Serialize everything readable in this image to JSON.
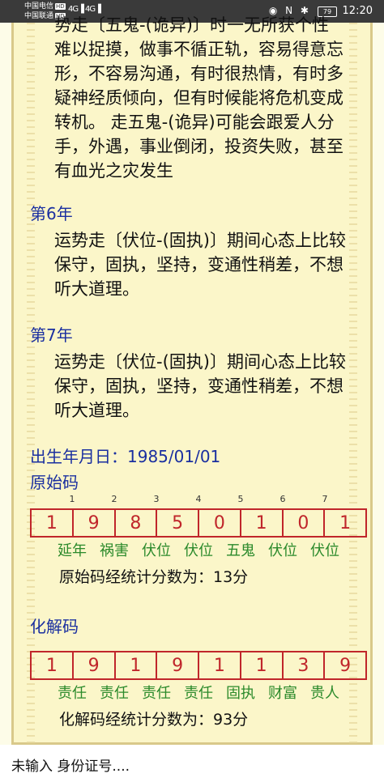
{
  "status_bar": {
    "carrier1": "中国电信",
    "carrier2": "中国联通",
    "hd": "HD",
    "signal1": "4G",
    "signal2": "4G",
    "icons": "◉ N ✱",
    "battery": "79",
    "time": "12:20"
  },
  "partial_para": {
    "line0": "势走〔五鬼-(诡异)〕时一无所获个性",
    "lines": [
      "难以捉摸，做事不循正轨，容易得意忘",
      "形，不容易沟通，有时很热情，有时多",
      "疑神经质倾向，但有时候能将危机变成",
      "转机。 走五鬼-(诡异)可能会跟爱人分",
      "手，外遇，事业倒闭，投资失败，甚至",
      "有血光之灾发生"
    ]
  },
  "year6": {
    "title": "第6年",
    "lines": [
      "运势走〔伏位-(固执)〕期间心态上比较",
      "保守，固执，坚持，变通性稍差，不想",
      "听大道理。"
    ]
  },
  "year7": {
    "title": "第7年",
    "lines": [
      "运势走〔伏位-(固执)〕期间心态上比较",
      "保守，固执，坚持，变通性稍差，不想",
      "听大道理。"
    ]
  },
  "birth": {
    "label": "出生年月日：1985/01/01"
  },
  "original": {
    "title": "原始码",
    "indices": [
      "1",
      "2",
      "3",
      "4",
      "5",
      "6",
      "7"
    ],
    "digits": [
      "1",
      "9",
      "8",
      "5",
      "0",
      "1",
      "0",
      "1"
    ],
    "labels": [
      "延年",
      "祸害",
      "伏位",
      "伏位",
      "五鬼",
      "伏位",
      "伏位"
    ],
    "score": "原始码经统计分数为：13分"
  },
  "resolved": {
    "title": "化解码",
    "digits": [
      "1",
      "9",
      "1",
      "9",
      "1",
      "1",
      "3",
      "9"
    ],
    "labels": [
      "责任",
      "责任",
      "责任",
      "责任",
      "固执",
      "财富",
      "贵人"
    ],
    "score": "化解码经统计分数为：93分"
  },
  "footer": {
    "text": "未输入 身份证号...."
  },
  "colors": {
    "page_bg": "#fbf6c9",
    "code_red": "#c0262b",
    "label_green": "#2b8a2b",
    "heading_blue": "#1a2fa0"
  }
}
